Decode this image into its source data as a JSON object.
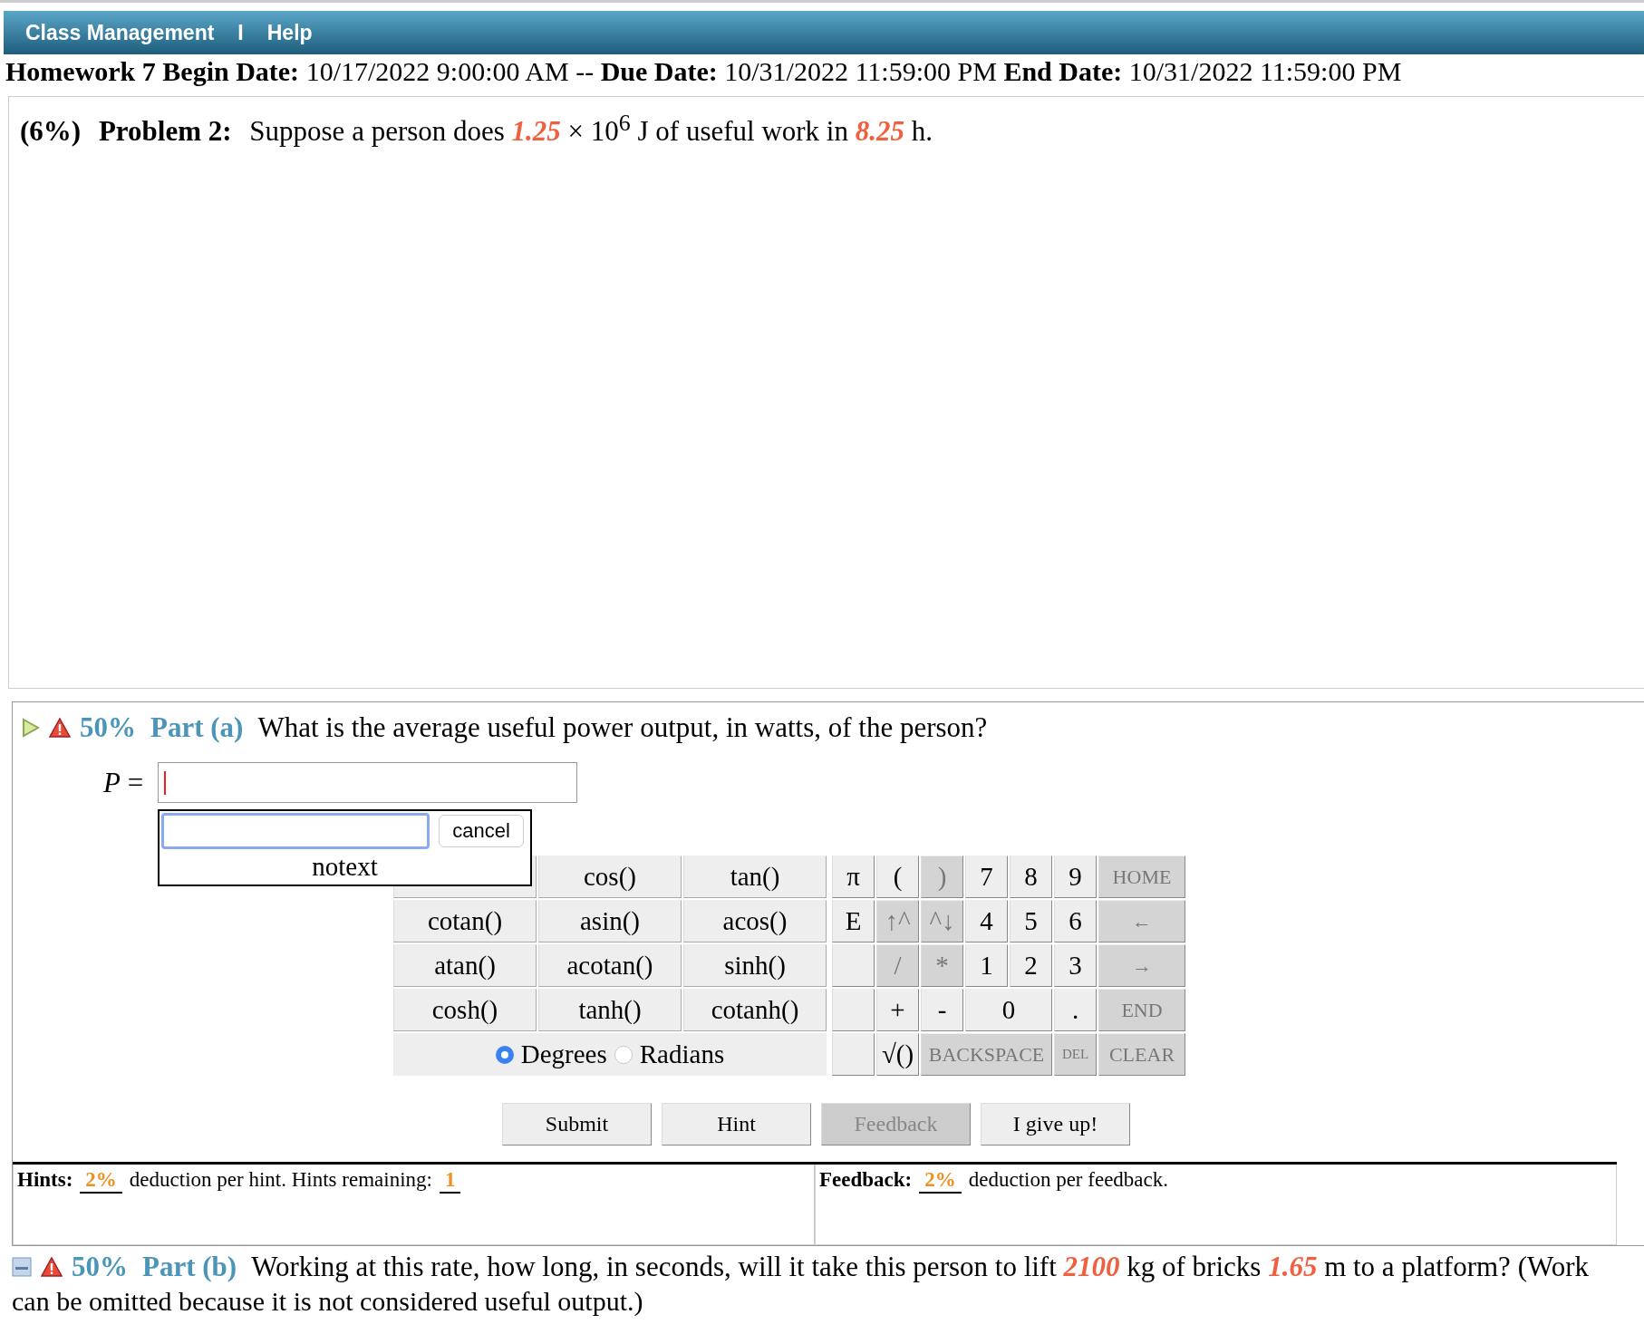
{
  "nav": {
    "items": [
      {
        "label": "Class Management"
      },
      {
        "label": "Help"
      }
    ],
    "separator": "I"
  },
  "assignment": {
    "summary": "**Homework 7 Begin Date:** 10/17/2022 9:00:00 AM -- **Due Date:** 10/31/2022 11:59:00 PM **End Date:** 10/31/2022 11:59:00 PM"
  },
  "problem": {
    "weight": "(6%)",
    "label": "Problem 2:",
    "statement": "Suppose a person does *1.25* × 10$^{6}$ J of useful work in *8.25* h."
  },
  "parts": [
    {
      "expanded": true,
      "weight": "50%",
      "label": "Part (a)",
      "question": "What is the average useful power output, in watts, of the person?",
      "answer": {
        "label": "*P* =",
        "popup": {
          "cancel": "cancel",
          "message": "notext"
        }
      },
      "functions": [
        "cos()",
        "tan()",
        "cotan()",
        "asin()",
        "acos()",
        "atan()",
        "acotan()",
        "sinh()",
        "cosh()",
        "tanh()",
        "cotanh()"
      ],
      "angle_modes": [
        {
          "label": "Degrees",
          "selected": true
        },
        {
          "label": "Radians",
          "selected": false
        }
      ],
      "keys": [
        {
          "label": "π",
          "kind": "single",
          "disabled": false
        },
        {
          "label": "(",
          "kind": "single",
          "disabled": false
        },
        {
          "label": ")",
          "kind": "single",
          "disabled": true
        },
        {
          "label": "7",
          "kind": "single",
          "disabled": false
        },
        {
          "label": "8",
          "kind": "single",
          "disabled": false
        },
        {
          "label": "9",
          "kind": "single",
          "disabled": false
        },
        {
          "label": "HOME",
          "kind": "double",
          "disabled": true
        },
        {
          "label": "E",
          "kind": "single",
          "disabled": false
        },
        {
          "label": "↑^",
          "kind": "single",
          "disabled": true
        },
        {
          "label": "^↓",
          "kind": "single",
          "disabled": true
        },
        {
          "label": "4",
          "kind": "single",
          "disabled": false
        },
        {
          "label": "5",
          "kind": "single",
          "disabled": false
        },
        {
          "label": "6",
          "kind": "single",
          "disabled": false
        },
        {
          "label": "←",
          "kind": "double",
          "disabled": true
        },
        {
          "kind": "blank"
        },
        {
          "label": "/",
          "kind": "single",
          "disabled": true
        },
        {
          "label": "*",
          "kind": "single",
          "disabled": true
        },
        {
          "label": "1",
          "kind": "single",
          "disabled": false
        },
        {
          "label": "2",
          "kind": "single",
          "disabled": false
        },
        {
          "label": "3",
          "kind": "single",
          "disabled": false
        },
        {
          "label": "→",
          "kind": "double",
          "disabled": true
        },
        {
          "kind": "blank"
        },
        {
          "label": "+",
          "kind": "single",
          "disabled": false
        },
        {
          "label": "-",
          "kind": "single",
          "disabled": false
        },
        {
          "label": "0",
          "kind": "double",
          "disabled": false
        },
        {
          "label": ".",
          "kind": "single",
          "disabled": false
        },
        {
          "label": "END",
          "kind": "double",
          "disabled": true
        },
        {
          "kind": "blank"
        },
        {
          "label": "√()",
          "kind": "single",
          "disabled": false
        },
        {
          "label": "BACKSPACE",
          "kind": "triple",
          "disabled": true
        },
        {
          "label": "DEL",
          "kind": "small",
          "disabled": true
        },
        {
          "label": "CLEAR",
          "kind": "double",
          "disabled": true
        }
      ],
      "buttons": [
        {
          "label": "Submit",
          "disabled": false
        },
        {
          "label": "Hint",
          "disabled": false
        },
        {
          "label": "Feedback",
          "disabled": true
        },
        {
          "label": "I give up!",
          "disabled": false
        }
      ],
      "penalties": [
        [
          {
            "kind": "label",
            "text": "Hints:"
          },
          {
            "kind": "value",
            "text": "2%"
          },
          {
            "kind": "text",
            "text": "deduction per hint. Hints remaining:"
          },
          {
            "kind": "value",
            "text": "1"
          }
        ],
        [
          {
            "kind": "label",
            "text": "Feedback:"
          },
          {
            "kind": "value",
            "text": "2%"
          },
          {
            "kind": "text",
            "text": "deduction per feedback."
          }
        ]
      ]
    },
    {
      "expanded": false,
      "weight": "50%",
      "label": "Part (b)",
      "question": "Working at this rate, how long, in seconds, will it take this person to lift *2100* kg of bricks *1.65* m to a platform? (Work",
      "question_continued": "can be omitted because it is not considered useful output.)"
    }
  ]
}
